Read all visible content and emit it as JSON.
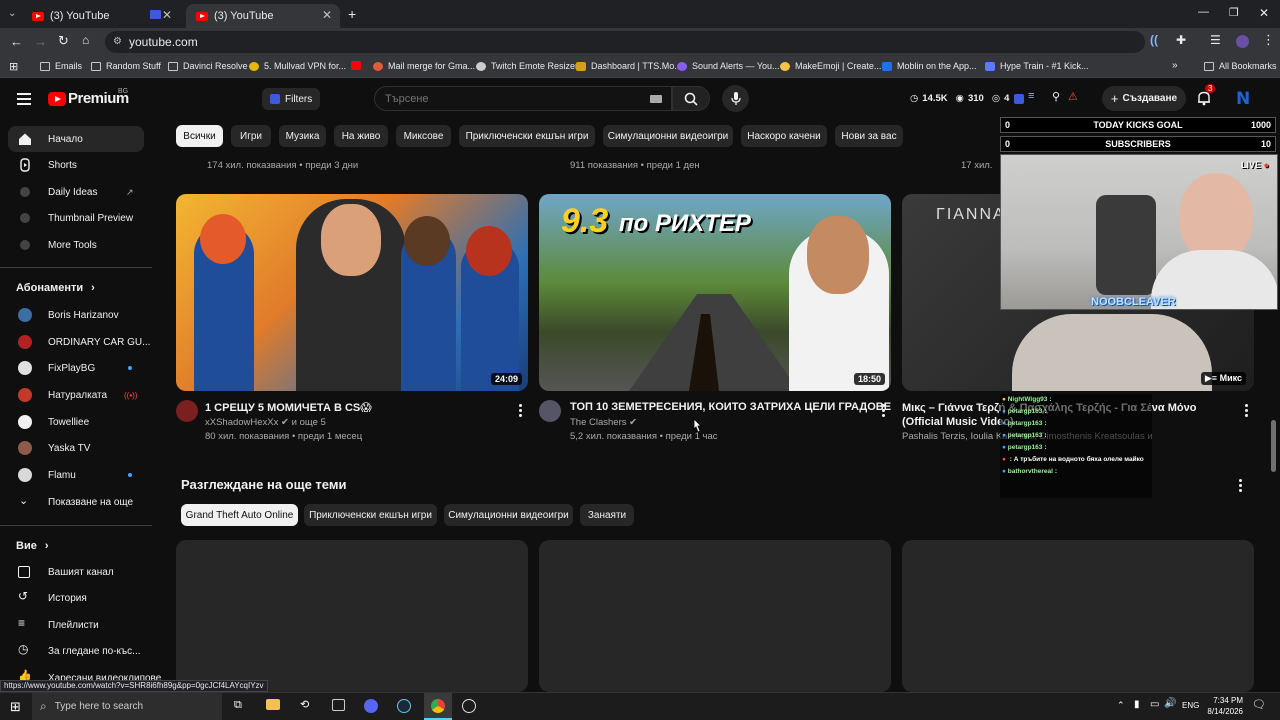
{
  "browser": {
    "tabs": [
      {
        "title": "(3) YouTube"
      },
      {
        "title": "(3) YouTube"
      }
    ],
    "url": "youtube.com",
    "bookmarks": [
      "Emails",
      "Random Stuff",
      "Davinci Resolve",
      "5. Mullvad VPN for...",
      "Mail merge for Gma...",
      "Twitch Emote Resizer",
      "Dashboard | TTS.Mo...",
      "Sound Alerts — You...",
      "MakeEmoji | Create...",
      "Moblin on the App...",
      "Hype Train - #1 Kick..."
    ],
    "all_bookmarks": "All Bookmarks",
    "status_url": "https://www.youtube.com/watch?v=SHR8i6fh89g&pp=0gcJCf4LAYcqIYzv"
  },
  "header": {
    "logo": "Premium",
    "region": "BG",
    "filters": "Filters",
    "search_placeholder": "Търсене",
    "stats": {
      "subs": "14.5K",
      "views": "310",
      "live": "4"
    },
    "create": "Създаване",
    "notif_count": "3"
  },
  "sidebar": {
    "main": [
      {
        "label": "Начало",
        "icon": "home-icon"
      },
      {
        "label": "Shorts",
        "icon": "shorts-icon"
      },
      {
        "label": "Daily Ideas",
        "icon": "ideas-icon"
      },
      {
        "label": "Thumbnail Preview",
        "icon": "thumbnail-icon"
      },
      {
        "label": "More Tools",
        "icon": "tools-icon"
      }
    ],
    "subs_title": "Абонаменти",
    "subs": [
      {
        "label": "Boris Harizanov",
        "color": "#3a6ea5",
        "badge": ""
      },
      {
        "label": "ORDINARY CAR GU...",
        "color": "#b22222",
        "badge": ""
      },
      {
        "label": "FixPlayBG",
        "color": "#e0e0e0",
        "badge": "dot"
      },
      {
        "label": "Натуралката",
        "color": "#c0392b",
        "badge": "live"
      },
      {
        "label": "Towelliee",
        "color": "#f1f1f1",
        "badge": ""
      },
      {
        "label": "Yaska TV",
        "color": "#8e5a4a",
        "badge": ""
      },
      {
        "label": "Flamu",
        "color": "#d9d9d9",
        "badge": "dot"
      }
    ],
    "show_more": "Показване на още",
    "you_title": "Вие",
    "you": [
      {
        "label": "Вашият канал",
        "icon": "channel-icon"
      },
      {
        "label": "История",
        "icon": "history-icon"
      },
      {
        "label": "Плейлисти",
        "icon": "playlist-icon"
      },
      {
        "label": "За гледане по-къс...",
        "icon": "watch-later-icon"
      },
      {
        "label": "Харесани видеоклипове",
        "icon": "like-icon"
      }
    ]
  },
  "chips": [
    "Всички",
    "Игри",
    "Музика",
    "На живо",
    "Миксове",
    "Приключенски екшън игри",
    "Симулационни видеоигри",
    "Наскоро качени",
    "Нови за вас"
  ],
  "prev_row_meta": [
    "174 хил. показвания • преди 3 дни",
    "911 показвания • преди 1 ден",
    "17 хил."
  ],
  "videos": [
    {
      "title": "1 СРЕЩУ 5 МОМИЧЕТА В CS😱",
      "channel": "xXShadowHexXx",
      "verified": true,
      "extra": "и още 5",
      "meta": "80 хил. показвания • преди 1 месец",
      "duration": "24:09"
    },
    {
      "title": "ТОП 10 ЗЕМЕТРЕСЕНИЯ, КОИТО ЗАТРИХА ЦЕЛИ ГРАДОВЕ",
      "channel": "The Clashers",
      "verified": true,
      "extra": "",
      "meta": "5,2 хил. показвания • преди 1 час",
      "duration": "18:50",
      "thumb_text": "9.3 по РИХТЕР"
    },
    {
      "title": "Μικς – Γιάννα Τερζή & Πασχάλης Τερζής - Για Σένα Μόνο (Official Music Video)",
      "channel": "Pashalis Terzis, Ioulia Kallimani, Dimosthenis Kreatsoulas и много други",
      "verified": false,
      "extra": "",
      "meta": "",
      "duration": "Микс",
      "thumb_text": "ΓΙΑΝΝΑ"
    }
  ],
  "topics": {
    "title": "Разглеждане на още теми",
    "chips": [
      "Grand Theft Auto Online",
      "Приключенски екшън игри",
      "Симулационни видеоигри",
      "Занаяти"
    ]
  },
  "overlay": {
    "goal1": {
      "left": "0",
      "label": "TODAY KICKS GOAL",
      "right": "1000"
    },
    "goal2": {
      "left": "0",
      "label": "SUBSCRIBERS",
      "right": "10"
    },
    "live": "LIVE",
    "streamer": "NOOBCLEAVER",
    "chat": [
      {
        "user": "NightWigg93",
        "msg": ":"
      },
      {
        "user": "petargp163",
        "msg": ":"
      },
      {
        "user": "petargp163",
        "msg": ":"
      },
      {
        "user": "petargp163",
        "msg": ":"
      },
      {
        "user": "petargp163",
        "msg": ":"
      },
      {
        "user": "",
        "msg": ": А тръбите на водното бяха олеле майко"
      },
      {
        "user": "bathorvthereal",
        "msg": ":"
      }
    ]
  },
  "taskbar": {
    "search": "Type here to search",
    "lang": "ENG",
    "time": "7:34 PM",
    "date": "8/14/2026"
  }
}
